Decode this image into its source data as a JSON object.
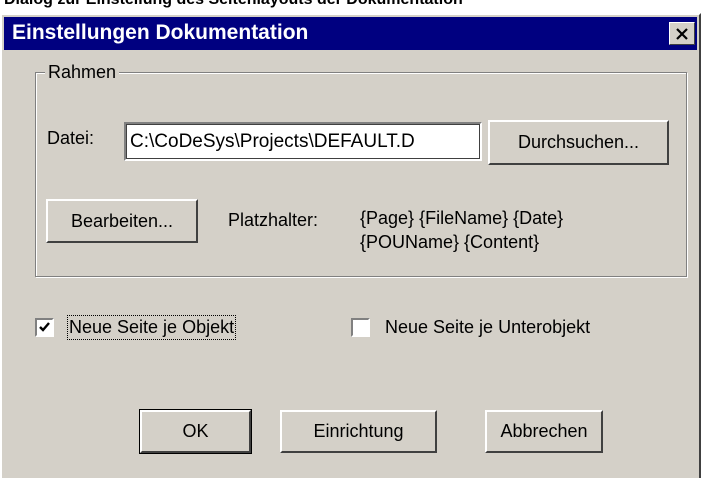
{
  "page_caption": "Dialog zur Einstellung des Seitenlayouts der Dokumentation",
  "dialog": {
    "title": "Einstellungen Dokumentation",
    "close_symbol": "×"
  },
  "frame_group": {
    "legend": "Rahmen",
    "file_label": "Datei:",
    "file_value": "C:\\CoDeSys\\Projects\\DEFAULT.D",
    "browse_button": "Durchsuchen...",
    "edit_button": "Bearbeiten...",
    "placeholder_label": "Platzhalter:",
    "placeholder_line1": "{Page} {FileName} {Date}",
    "placeholder_line2": "{POUName} {Content}"
  },
  "options": {
    "new_page_per_object": {
      "label": "Neue Seite je Objekt",
      "checked": true
    },
    "new_page_per_subobject": {
      "label": "Neue Seite je Unterobjekt",
      "checked": false
    }
  },
  "buttons": {
    "ok": "OK",
    "setup": "Einrichtung",
    "cancel": "Abbrechen"
  }
}
